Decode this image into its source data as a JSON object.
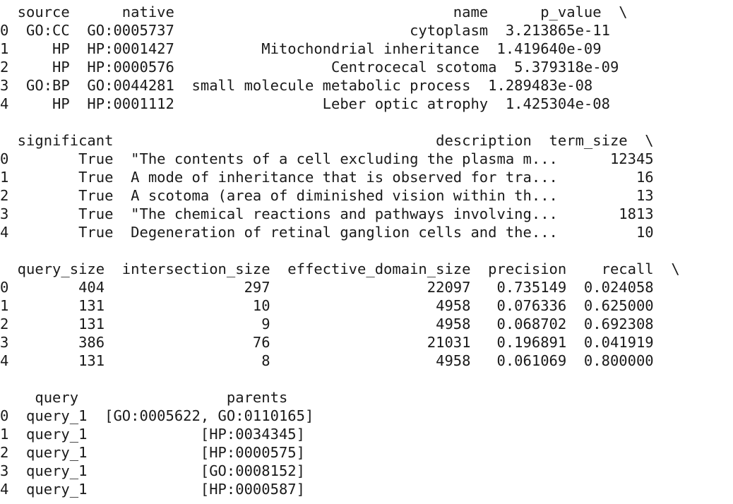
{
  "output": {
    "blocks": [
      {
        "header": "  source      native                                name      p_value  \\",
        "rows": [
          "0  GO:CC  GO:0005737                           cytoplasm  3.213865e-11",
          "1     HP  HP:0001427          Mitochondrial inheritance  1.419640e-09",
          "2     HP  HP:0000576                  Centrocecal scotoma  5.379318e-09",
          "3  GO:BP  GO:0044281  small molecule metabolic process  1.289483e-08",
          "4     HP  HP:0001112                 Leber optic atrophy  1.425304e-08"
        ]
      },
      {
        "header": "  significant                                     description  term_size  \\",
        "rows": [
          "0        True  \"The contents of a cell excluding the plasma m...      12345",
          "1        True  A mode of inheritance that is observed for tra...         16",
          "2        True  A scotoma (area of diminished vision within th...         13",
          "3        True  \"The chemical reactions and pathways involving...       1813",
          "4        True  Degeneration of retinal ganglion cells and the...         10"
        ]
      },
      {
        "header": "  query_size  intersection_size  effective_domain_size  precision    recall  \\",
        "rows": [
          "0        404                297                  22097   0.735149  0.024058",
          "1        131                 10                   4958   0.076336  0.625000",
          "2        131                  9                   4958   0.068702  0.692308",
          "3        386                 76                  21031   0.196891  0.041919",
          "4        131                  8                   4958   0.061069  0.800000"
        ]
      },
      {
        "header": "    query                 parents",
        "rows": [
          "0  query_1  [GO:0005622, GO:0110165]",
          "1  query_1             [HP:0034345]",
          "2  query_1             [HP:0000575]",
          "3  query_1             [GO:0008152]",
          "4  query_1             [HP:0000587]"
        ]
      }
    ]
  }
}
